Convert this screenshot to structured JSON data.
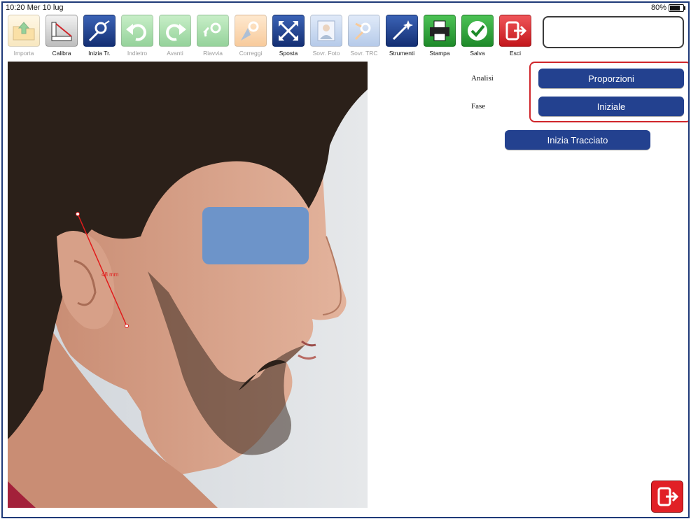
{
  "status": {
    "time": "10:20  Mer 10 lug",
    "battery": "80%"
  },
  "toolbar": {
    "items": [
      {
        "label": "Importa",
        "icon": "import-folder-icon"
      },
      {
        "label": "Calibra",
        "icon": "calibrate-ruler-icon"
      },
      {
        "label": "Inizia Tr.",
        "icon": "start-tracing-icon"
      },
      {
        "label": "Indietro",
        "icon": "undo-arrow-icon"
      },
      {
        "label": "Avanti",
        "icon": "redo-arrow-icon"
      },
      {
        "label": "Riavvia",
        "icon": "restart-icon"
      },
      {
        "label": "Correggi",
        "icon": "correct-icon"
      },
      {
        "label": "Sposta",
        "icon": "move-arrows-icon"
      },
      {
        "label": "Sovr. Foto",
        "icon": "overlay-photo-icon"
      },
      {
        "label": "Sovr. TRC",
        "icon": "overlay-trc-icon"
      },
      {
        "label": "Strumenti",
        "icon": "tools-wand-icon"
      },
      {
        "label": "Stampa",
        "icon": "printer-icon"
      },
      {
        "label": "Salva",
        "icon": "save-check-icon"
      },
      {
        "label": "Esci",
        "icon": "exit-door-icon"
      }
    ]
  },
  "photo": {
    "measure_label": "48 mm"
  },
  "panel": {
    "analisi_label": "Analisi",
    "analisi_value": "Proporzioni",
    "fase_label": "Fase",
    "fase_value": "Iniziale",
    "start_button": "Inizia Tracciato"
  },
  "colors": {
    "accent_blue": "#23418f",
    "highlight_red": "#d0262b",
    "exit_red": "#e12026",
    "tracing_red": "#e11b1b"
  }
}
